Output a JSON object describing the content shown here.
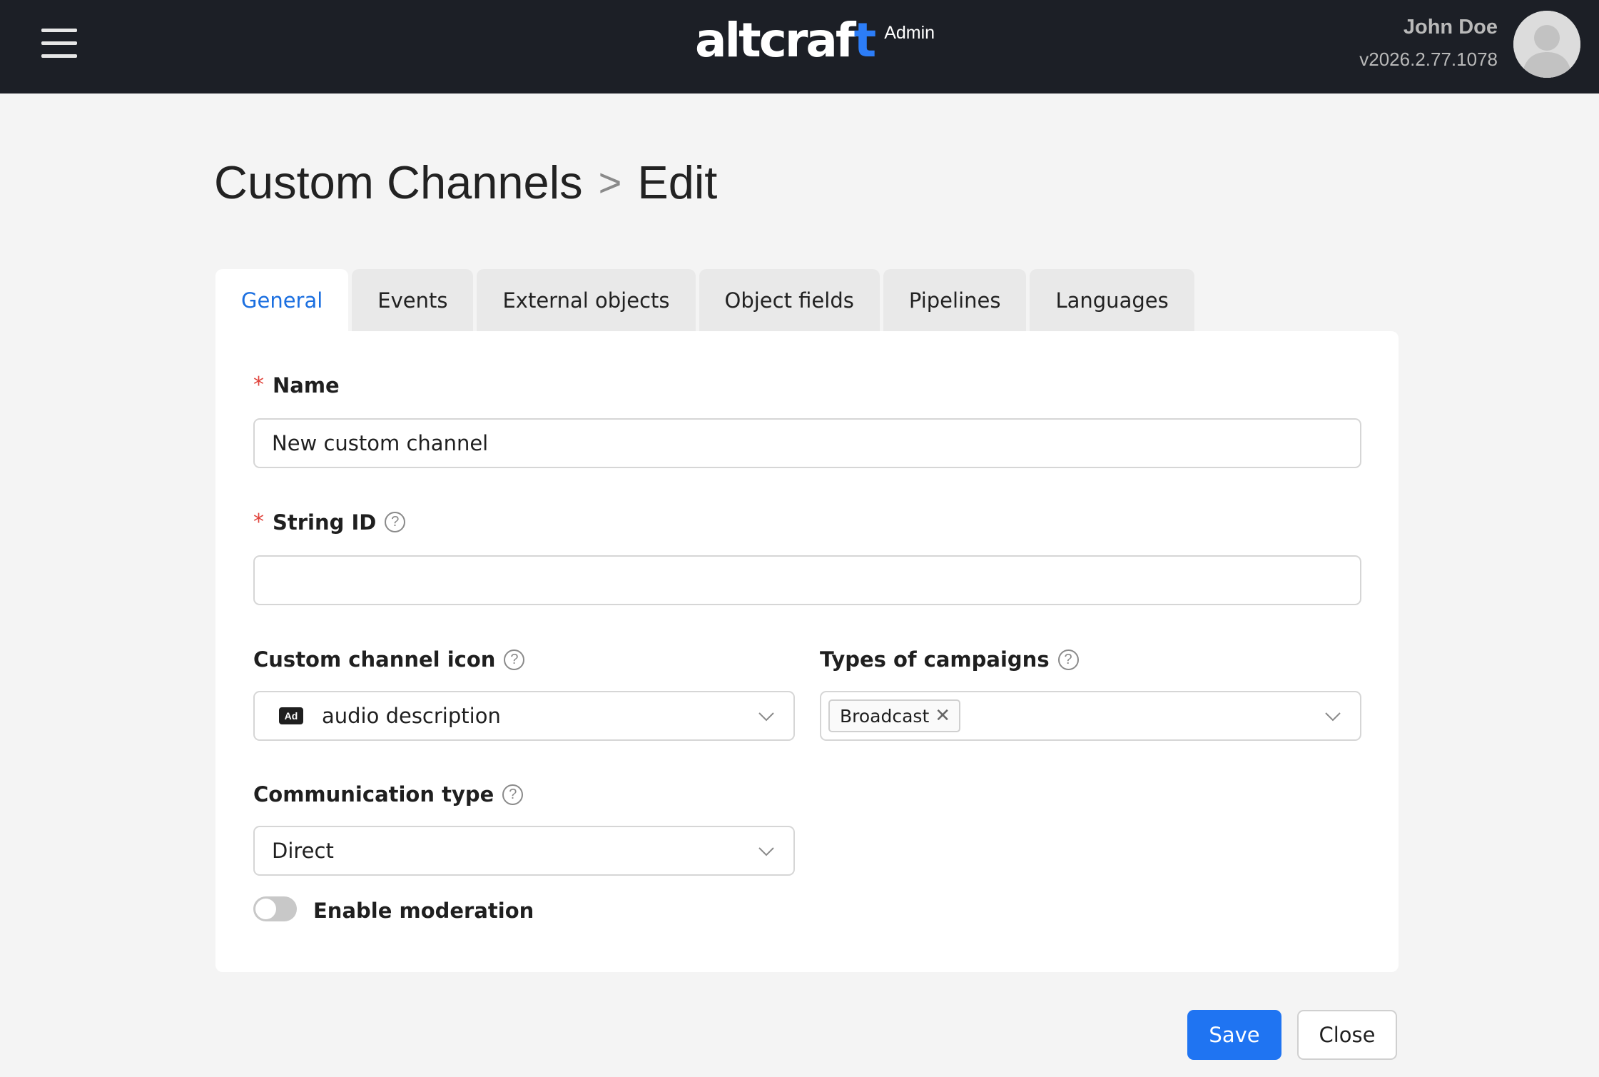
{
  "header": {
    "logo_main": "altcraf",
    "logo_last": "t",
    "logo_badge": "Admin",
    "user_name": "John Doe",
    "version": "v2026.2.77.1078",
    "menu_icon": "hamburger-menu-icon",
    "avatar_icon": "user-avatar-icon"
  },
  "breadcrumb": {
    "section": "Custom Channels",
    "separator": ">",
    "page": "Edit"
  },
  "tabs": [
    {
      "label": "General",
      "active": true
    },
    {
      "label": "Events",
      "active": false
    },
    {
      "label": "External objects",
      "active": false
    },
    {
      "label": "Object fields",
      "active": false
    },
    {
      "label": "Pipelines",
      "active": false
    },
    {
      "label": "Languages",
      "active": false
    }
  ],
  "form": {
    "required_mark": "*",
    "help_mark": "?",
    "name": {
      "label": "Name",
      "value": "New custom channel"
    },
    "string_id": {
      "label": "String ID",
      "value": ""
    },
    "icon": {
      "label": "Custom channel icon",
      "value": "audio description",
      "icon_badge": "Ad"
    },
    "campaign_types": {
      "label": "Types of campaigns",
      "tags": [
        "Broadcast"
      ],
      "remove_glyph": "✕"
    },
    "communication_type": {
      "label": "Communication type",
      "value": "Direct"
    },
    "moderation": {
      "label": "Enable moderation",
      "enabled": false
    }
  },
  "actions": {
    "save_label": "Save",
    "close_label": "Close"
  },
  "colors": {
    "header_bg": "#1c1f26",
    "accent": "#1f74f2",
    "active_tab": "#1b6fe0",
    "required": "#e0443c"
  }
}
